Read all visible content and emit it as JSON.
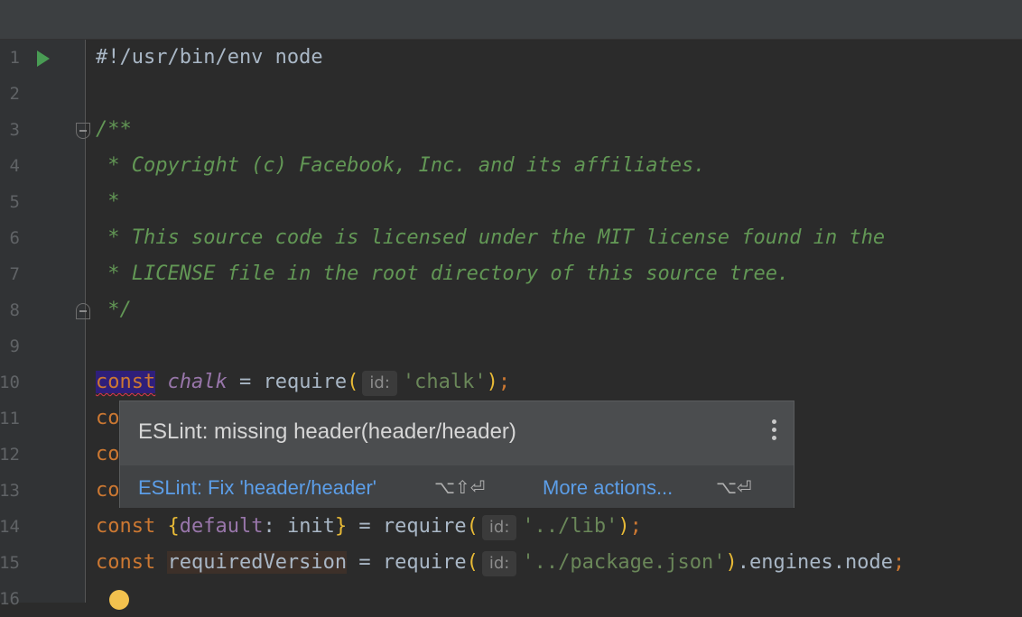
{
  "editor": {
    "lines": [
      {
        "num": "1",
        "text": "#!/usr/bin/env node"
      },
      {
        "num": "2"
      },
      {
        "num": "3",
        "text": "/**"
      },
      {
        "num": "4",
        "text": " * Copyright (c) Facebook, Inc. and its affiliates."
      },
      {
        "num": "5",
        "text": " *"
      },
      {
        "num": "6",
        "text": " * This source code is licensed under the MIT license found in the"
      },
      {
        "num": "7",
        "text": " * LICENSE file in the root directory of this source tree."
      },
      {
        "num": "8",
        "text": " */"
      },
      {
        "num": "9"
      },
      {
        "num": "10",
        "kw": "const",
        "var": "chalk",
        "op": " = require",
        "lp": "(",
        "hint": "id:",
        "str": "'chalk'",
        "rp": ")",
        "semi": ";"
      },
      {
        "num": "11",
        "kw": "co"
      },
      {
        "num": "12",
        "kw": "co"
      },
      {
        "num": "13",
        "kw": "co"
      },
      {
        "num": "14",
        "kw": "const",
        "lb": "{",
        "prop": "default",
        "mid": ": init",
        "rb": "}",
        "op": " = require",
        "lp": "(",
        "hint": "id:",
        "str": "'../lib'",
        "rp": ")",
        "semi": ";"
      },
      {
        "num": "15",
        "kw": "const",
        "var": "requiredVersion",
        "op": " = require",
        "lp": "(",
        "hint": "id:",
        "str": "'../package.json'",
        "rp": ")",
        "tail": ".engines.node",
        "semi": ";"
      },
      {
        "num": "16"
      }
    ]
  },
  "popup": {
    "title": "ESLint: missing header(header/header)",
    "fix_label": "ESLint: Fix 'header/header'",
    "fix_shortcut": "⌥⇧⏎",
    "more_label": "More actions...",
    "more_shortcut": "⌥⏎"
  },
  "icons": {
    "run": "run-gutter-icon",
    "fold": "fold-icon",
    "menu": "more-vertical-icon",
    "bulb": "lightbulb-icon"
  },
  "colors": {
    "background": "#2b2b2b",
    "keyword": "#cc7832",
    "comment": "#629755",
    "string": "#6a8759",
    "link": "#5c9ee8"
  }
}
